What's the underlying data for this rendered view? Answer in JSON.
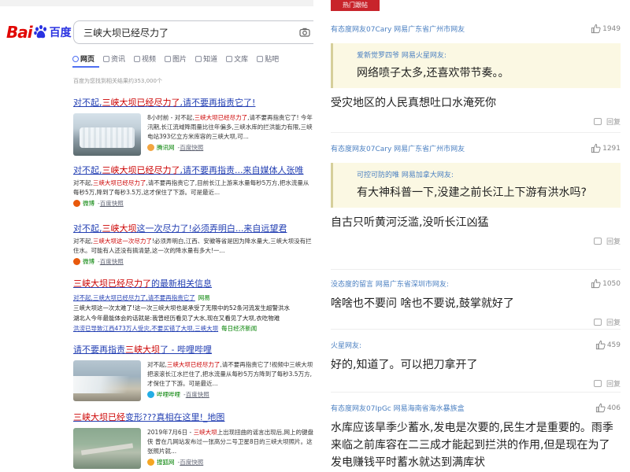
{
  "search": {
    "logo_left": "Bai",
    "logo_right": "百度",
    "query": "三峡大坝已经尽力了",
    "tabs": [
      {
        "label": "网页"
      },
      {
        "label": "资讯"
      },
      {
        "label": "视频"
      },
      {
        "label": "图片"
      },
      {
        "label": "知道"
      },
      {
        "label": "文库"
      },
      {
        "label": "贴吧"
      }
    ],
    "result_count": "百度为您找到相关结果约353,000个",
    "results": [
      {
        "title_pre": "对不起,",
        "title_hl": "三峡大坝已经尽力了",
        "title_post": ",请不要再指责它了!",
        "abstract_pre": "8小时前 - 对不起,",
        "abstract_hl": "三峡大坝已经尽力了",
        "abstract_post": ",请不要再指责它了! 今年汛期,长江流域降雨量比往年偏多,三峡水库的拦洪能力有限,三峡电站393亿立方米库容的三峡大坝,可...",
        "source": "腾讯网",
        "snapshot": "百度快照"
      },
      {
        "title_pre": "对不起,",
        "title_hl": "三峡大坝已经尽力了",
        "title_post": ",请不要再指责...来自媒体人张唯",
        "abstract_pre": "对不起,",
        "abstract_hl": "三峡大坝已经尽力了",
        "abstract_post": ",请不要再指责它了,目前长江上游来水量每秒5万方,把水流量从每秒5万,降到了每秒3.5万,这才保住了下游。可是最近...",
        "source": "微博",
        "snapshot": "百度快照"
      },
      {
        "title_pre": "对不起,",
        "title_hl": "三峡大坝",
        "title_post": "这一次尽力了!必须弄明白...来自远望君",
        "abstract_pre": "对不起,",
        "abstract_hl": "三峡大坝这一次尽力了",
        "abstract_post": "!必须弄明白,江西、安徽等省是因为降水量大,三峡大坝没有拦住水。可能有人还没有搞清楚,这一次的降水量有多大!一...",
        "source": "微博",
        "snapshot": "百度快照"
      }
    ],
    "news_block": {
      "title_hl": "三峡大坝已经尽力了",
      "title_post": "的最新相关信息",
      "items": [
        {
          "text": "对不起,三峡大坝已经尽力了,请不要再指责它了",
          "source": "网易"
        },
        {
          "text": "三峡大坝这一次太难了!这一次三峡大坝也是承受了无限中的52条河流发生超警洪水",
          "source": ""
        },
        {
          "text": "湖北人今年最能体会的话就是:我曾经历看见了大水,现在又看见了大坝,衣吃物难",
          "source": ""
        },
        {
          "text": "洪涝已导致江西473万人受灾,不要买错了大坝,三峡大坝",
          "source": "每日经济新闻"
        }
      ]
    },
    "results_b": [
      {
        "title_pre": "请不要再指责",
        "title_hl": "三峡大坝",
        "title_post": "了 - 哔哩哔哩",
        "abstract_pre": "对不起,",
        "abstract_hl": "三峡大坝已经尽力了",
        "abstract_post": ",请不要再指责它了!视频中三峡大坝把滚滚长江水拦住了,把水流量从每秒5万方降到了每秒3.5万方,才保住了下游。可是最近...",
        "source": "哔哩哔哩",
        "snapshot": "百度快照"
      },
      {
        "title_pre": "",
        "title_hl": "三峡大坝已经",
        "title_post": "变形???真相在这里!_地图",
        "abstract_pre": "2019年7月6日 - ",
        "abstract_hl": "三峡大坝",
        "abstract_post": "上出现扭曲的谣言出现后,网上的键盘侠 曾在几网站发布过一张高分二号卫星8日的三峡大坝照片。这张照片就...",
        "source": "搜狐网",
        "snapshot": "百度快照"
      }
    ]
  },
  "comments": {
    "tab_label": "热门跟帖",
    "reply_label": "回复",
    "items": [
      {
        "user": "有态度网友07Cary 网易广东省广州市网友",
        "likes": "1949",
        "quote_user": "爱新觉罗四爷 网易火星网友:",
        "quote_text": "网络喷子太多,还喜欢带节奏。。",
        "text": "受灾地区的人民真想吐口水淹死你"
      },
      {
        "user": "有态度网友07Cary 网易广东省广州市网友",
        "likes": "1291",
        "quote_user": "可控可防的唯 网易加拿大网友:",
        "quote_text": "有大神科普一下,没建之前长江上下游有洪水吗?",
        "text": "自古只听黄河泛滥,没听长江凶猛"
      },
      {
        "user": "没态度的留言 网易广东省深圳市网友:",
        "likes": "1050",
        "quote_user": "",
        "quote_text": "",
        "text": "啥啥也不要问 啥也不要说,鼓掌就好了"
      },
      {
        "user": "火星网友:",
        "likes": "459",
        "quote_user": "",
        "quote_text": "",
        "text": "好的,知道了。可以把刀拿开了"
      },
      {
        "user": "有态度网友07IpGc 网易海南省海水暴族盒",
        "likes": "406",
        "quote_user": "",
        "quote_text": "",
        "text": "水库应该旱季少蓄水,发电是次要的,民生才是重要的。雨季来临之前库容在二三成才能起到拦洪的作用,但是现在为了发电赚钱平时蓄水就达到满库状"
      }
    ]
  },
  "colors": {
    "baidu_red": "#e10602",
    "baidu_blue": "#2932e1",
    "link_blue": "#2440b3",
    "highlight_red": "#cc0000",
    "comment_user_blue": "#4a7fc1",
    "quote_bg": "#fbf8e3"
  }
}
